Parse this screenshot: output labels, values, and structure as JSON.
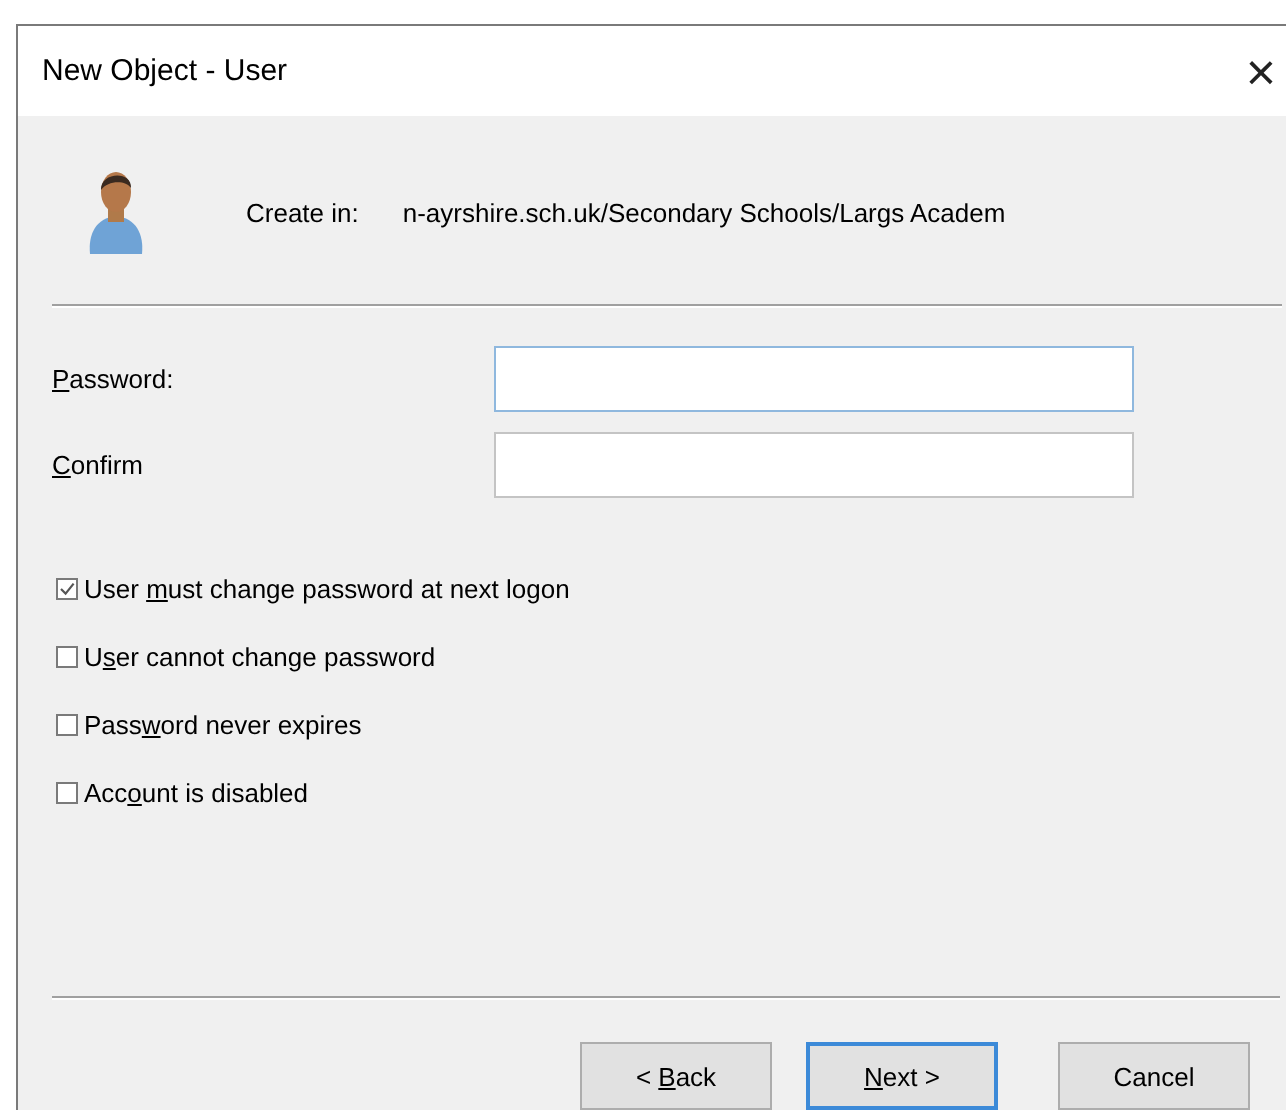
{
  "window": {
    "title": "New Object - User",
    "close": "×"
  },
  "create_in": {
    "label": "Create in:",
    "path": "n-ayrshire.sch.uk/Secondary Schools/Largs Academ"
  },
  "fields": [
    {
      "label": {
        "key": "P",
        "post": "assword:"
      },
      "focused": true
    },
    {
      "label": {
        "key": "C",
        "post": "onfirm"
      },
      "focused": false
    }
  ],
  "options": [
    {
      "label": {
        "pre": "User ",
        "key": "m",
        "post": "ust change password at next logon"
      },
      "checked": true
    },
    {
      "label": {
        "pre": "U",
        "key": "s",
        "post": "er cannot change password"
      },
      "checked": false
    },
    {
      "label": {
        "pre": "Pass",
        "key": "w",
        "post": "ord never expires"
      },
      "checked": false
    },
    {
      "label": {
        "pre": "Acc",
        "key": "o",
        "post": "unt is disabled"
      },
      "checked": false
    }
  ],
  "buttons": [
    {
      "label": {
        "pre": "< ",
        "key": "B",
        "post": "ack"
      },
      "default": false
    },
    {
      "label": {
        "key": "N",
        "post": "ext >"
      },
      "default": true
    },
    {
      "label": {
        "pre": "Cancel"
      },
      "default": false
    }
  ]
}
